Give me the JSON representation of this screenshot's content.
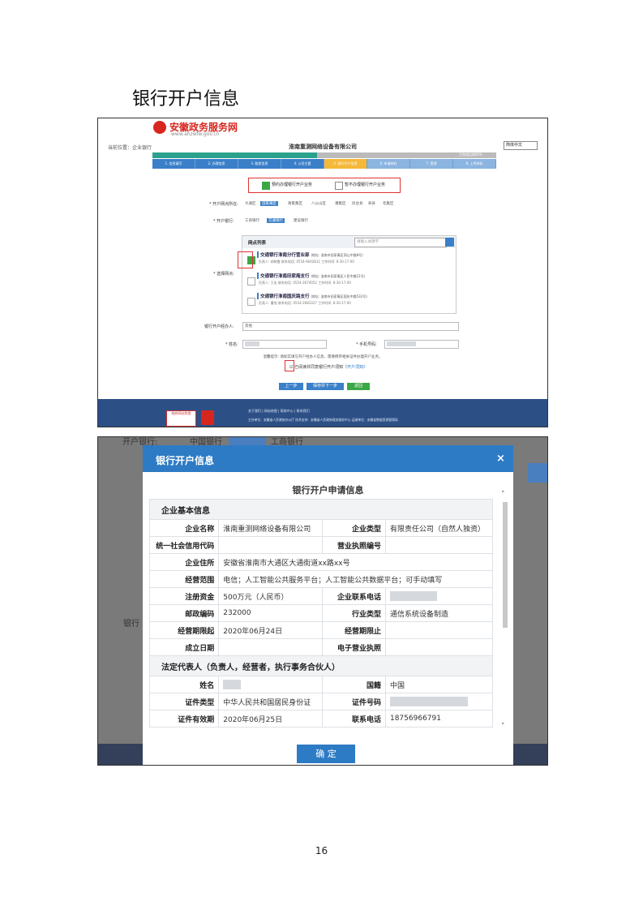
{
  "doc": {
    "heading": "银行开户信息",
    "page_number": "16"
  },
  "shot1": {
    "logo": "安徽政务服务网",
    "logo_url": "www.ahzwfw.gov.cn",
    "location": "当前位置：企业银行",
    "company": "淮南重测网络设备有限公司",
    "lang": "简体中文",
    "progress": "已完成比例65%",
    "steps": [
      "1. 信息填写",
      "2. 办理信息",
      "3. 股权信息",
      "4. 公司主要",
      "5. 银行开户信息",
      "6. 申请材料",
      "7. 受理",
      "8. 上传材料"
    ],
    "cb_yes": "预约办理银行开户业务",
    "cb_no": "暂不办理银行开户业务",
    "region_label": "* 开户网点所在:",
    "regions": [
      "大通区",
      "田家庵区",
      "谢家集区",
      "八公山区",
      "潘集区",
      "凤台县",
      "寿县",
      "毛集区"
    ],
    "region_selected": "田家庵区",
    "bank_label": "* 开户银行:",
    "banks": [
      "工商银行",
      "交通银行",
      "建设银行"
    ],
    "bank_selected": "交通银行",
    "list_title": "网点列表",
    "list_search": "请输入关键字",
    "pick_label": "* 选择网点:",
    "branches": [
      {
        "name": "交通银行淮南分行营业部",
        "addr": "(地址: 淮南市田家庵区洞山中路8号)",
        "contact": "负责人: 胡晓霞   联系电话: 0554-6642811   工作时间: 8:30-17:00",
        "checked": true
      },
      {
        "name": "交通银行淮南田家庵支行",
        "addr": "(地址: 淮南市田家庵区人民中路21号)",
        "contact": "负责人: 王宏   联系电话: 0554-2674052   工作时间: 8:30-17:00",
        "checked": false
      },
      {
        "name": "交通银行淮南国庆路支行",
        "addr": "(地址: 淮南市田家庵区国庆中路532号)",
        "contact": "负责人: 曹旭   联系电话: 0554-2683327   工作时间: 8:30-17:00",
        "checked": false
      }
    ],
    "handler_label": "银行开户经办人:",
    "handler_value": "其他",
    "name_label": "* 姓名:",
    "phone_label": "* 手机号码:",
    "note": "温馨提示: 请如实填写开户经办人信息，需要携带相关证件办理开户业务。",
    "agree": "已阅读并同意银行开户须知",
    "agree_link": "《开户须知》",
    "btn_prev": "上一步",
    "btn_save": "保存并下一步",
    "btn_back": "返回",
    "footer_links": "关于我们 | 网站地图 | 帮助中心 | 联系我们",
    "footer_org": "主办单位：安徽省人民政府办公厅    技术支持：安徽省人民政府政务服务中心    运维单位：安徽省数据资源管理局",
    "badge": "政府网站找错"
  },
  "shot2": {
    "bg_bank_label": "开户银行:",
    "bg_bank1": "中国银行",
    "bg_bank2": "工商银行",
    "bg_side": "银行",
    "modal_title": "银行开户信息",
    "close": "×",
    "sub_title": "银行开户申请信息",
    "sec_company": "企业基本信息",
    "sec_legal": "法定代表人（负责人，经营者，执行事务合伙人）",
    "company_rows": [
      [
        "企业名称",
        "淮南重测网络设备有限公司",
        "企业类型",
        "有限责任公司（自然人独资）"
      ],
      [
        "统一社会信用代码",
        "",
        "营业执照编号",
        ""
      ],
      [
        "企业住所",
        "安徽省淮南市大通区大通街道xx路xx号"
      ],
      [
        "经营范围",
        "电信；人工智能公共服务平台；人工智能公共数据平台；可手动填写"
      ],
      [
        "注册资金",
        "500万元（人民币）",
        "企业联系电话",
        ""
      ],
      [
        "邮政编码",
        "232000",
        "行业类型",
        "通信系统设备制造"
      ],
      [
        "经营期限起",
        "2020年06月24日",
        "经营期限止",
        ""
      ],
      [
        "成立日期",
        "",
        "电子营业执照",
        ""
      ]
    ],
    "legal_rows": [
      [
        "姓名",
        "",
        "国籍",
        "中国"
      ],
      [
        "证件类型",
        "中华人民共和国居民身份证",
        "证件号码",
        ""
      ],
      [
        "证件有效期",
        "2020年06月25日",
        "联系电话",
        "18756966791"
      ]
    ],
    "ok": "确 定"
  },
  "colors": {
    "accent": "#2d7bc4",
    "brand_red": "#d7261e",
    "check_green": "#3aa845",
    "footer_blue": "#2c4f86"
  }
}
